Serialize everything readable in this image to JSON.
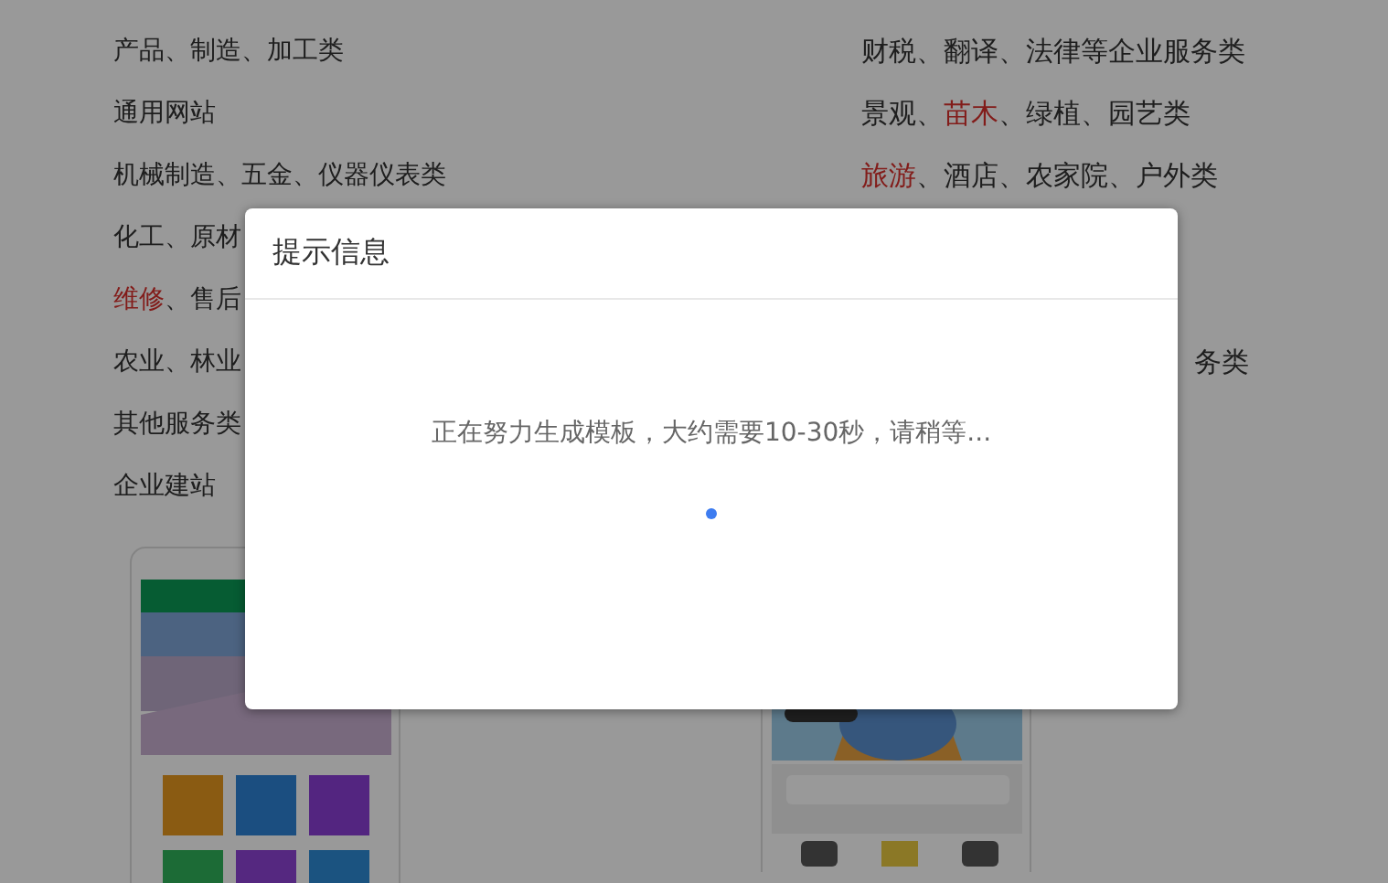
{
  "background_page": {
    "categories_left": [
      {
        "segments": [
          {
            "text": "产品、制造、加工类",
            "highlight": false
          }
        ]
      },
      {
        "segments": [
          {
            "text": "通用网站",
            "highlight": false
          }
        ]
      },
      {
        "segments": [
          {
            "text": "机械制造、五金、仪器仪表类",
            "highlight": false
          }
        ]
      },
      {
        "segments": [
          {
            "text": "化工、原材",
            "highlight": false
          }
        ]
      },
      {
        "segments": [
          {
            "text": "维修",
            "highlight": true
          },
          {
            "text": "、售后",
            "highlight": false
          }
        ]
      },
      {
        "segments": [
          {
            "text": "农业、林业",
            "highlight": false
          }
        ]
      },
      {
        "segments": [
          {
            "text": "其他服务类",
            "highlight": false
          }
        ]
      },
      {
        "segments": [
          {
            "text": "企业建站",
            "highlight": false
          }
        ]
      }
    ],
    "categories_right": [
      {
        "kind": "full",
        "segments": [
          {
            "text": "财税、翻译、法律等企业服务类",
            "highlight": false
          }
        ]
      },
      {
        "kind": "full",
        "segments": [
          {
            "text": "景观、",
            "highlight": false
          },
          {
            "text": "苗木",
            "highlight": true
          },
          {
            "text": "、绿植、园艺类",
            "highlight": false
          }
        ]
      },
      {
        "kind": "full",
        "segments": [
          {
            "text": "旅游",
            "highlight": true
          },
          {
            "text": "、酒店、农家院、户外类",
            "highlight": false
          }
        ]
      },
      {
        "kind": "hidden"
      },
      {
        "kind": "hidden"
      },
      {
        "kind": "cut",
        "segments": [
          {
            "text": "务类",
            "highlight": false
          }
        ]
      }
    ]
  },
  "dialog": {
    "title": "提示信息",
    "message": "正在努力生成模板，大约需要10-30秒，请稍等...",
    "loading": true
  }
}
